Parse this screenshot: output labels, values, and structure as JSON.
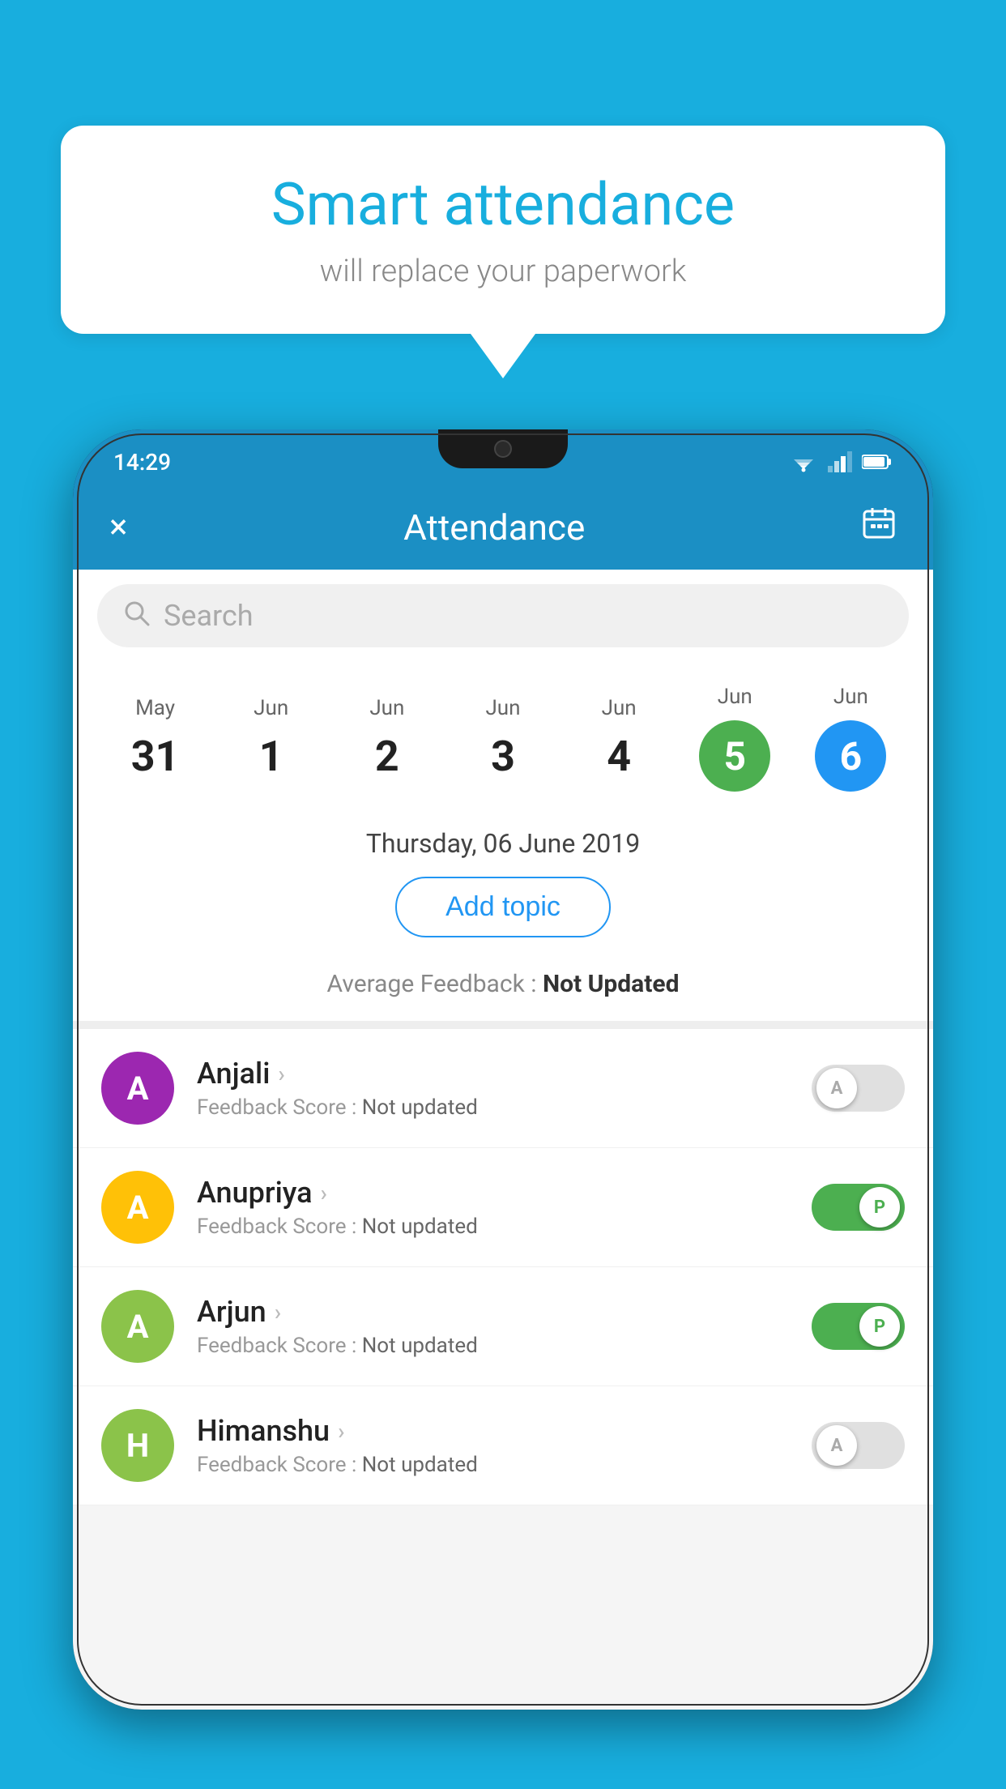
{
  "background_color": "#18AEDE",
  "speech_bubble": {
    "title": "Smart attendance",
    "subtitle": "will replace your paperwork"
  },
  "status_bar": {
    "time": "14:29"
  },
  "app_bar": {
    "title": "Attendance",
    "close_label": "×",
    "calendar_label": "📅"
  },
  "search": {
    "placeholder": "Search"
  },
  "calendar": {
    "days": [
      {
        "month": "May",
        "date": "31",
        "state": "normal"
      },
      {
        "month": "Jun",
        "date": "1",
        "state": "normal"
      },
      {
        "month": "Jun",
        "date": "2",
        "state": "normal"
      },
      {
        "month": "Jun",
        "date": "3",
        "state": "normal"
      },
      {
        "month": "Jun",
        "date": "4",
        "state": "normal"
      },
      {
        "month": "Jun",
        "date": "5",
        "state": "today"
      },
      {
        "month": "Jun",
        "date": "6",
        "state": "selected"
      }
    ]
  },
  "selected_date": "Thursday, 06 June 2019",
  "add_topic_label": "Add topic",
  "avg_feedback_label": "Average Feedback : ",
  "avg_feedback_value": "Not Updated",
  "students": [
    {
      "name": "Anjali",
      "avatar_letter": "A",
      "avatar_color": "#9C27B0",
      "feedback_label": "Feedback Score : ",
      "feedback_value": "Not updated",
      "toggle_state": "off",
      "toggle_letter": "A"
    },
    {
      "name": "Anupriya",
      "avatar_letter": "A",
      "avatar_color": "#FFC107",
      "feedback_label": "Feedback Score : ",
      "feedback_value": "Not updated",
      "toggle_state": "on",
      "toggle_letter": "P"
    },
    {
      "name": "Arjun",
      "avatar_letter": "A",
      "avatar_color": "#8BC34A",
      "feedback_label": "Feedback Score : ",
      "feedback_value": "Not updated",
      "toggle_state": "on",
      "toggle_letter": "P"
    },
    {
      "name": "Himanshu",
      "avatar_letter": "H",
      "avatar_color": "#8BC34A",
      "feedback_label": "Feedback Score : ",
      "feedback_value": "Not updated",
      "toggle_state": "off",
      "toggle_letter": "A"
    }
  ]
}
